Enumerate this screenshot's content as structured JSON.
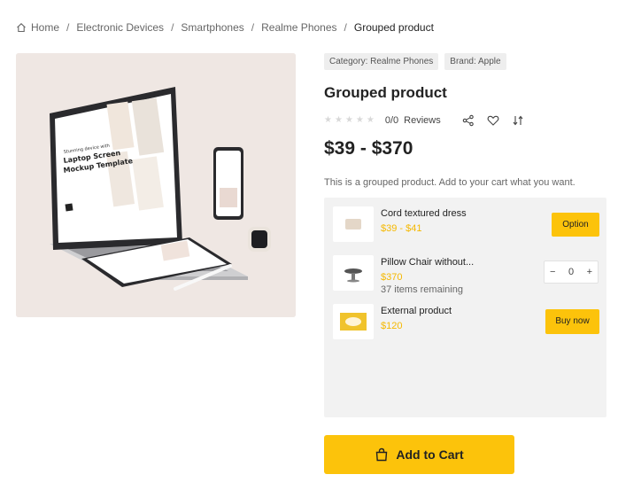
{
  "breadcrumb": {
    "items": [
      "Home",
      "Electronic Devices",
      "Smartphones",
      "Realme Phones",
      "Grouped product"
    ],
    "separator": "/"
  },
  "product": {
    "category_tag": "Category: Realme Phones",
    "brand_tag": "Brand: Apple",
    "title": "Grouped product",
    "rating": "0/0",
    "reviews_label": "Reviews",
    "price_range": "$39 - $370",
    "description": "This is a grouped product. Add to your cart what you want.",
    "add_to_cart_label": "Add to Cart"
  },
  "grouped_items": [
    {
      "name": "Cord textured dress",
      "price": "$39 - $41",
      "action_label": "Option"
    },
    {
      "name": "Pillow Chair without...",
      "price": "$370",
      "stock": "37 items remaining",
      "quantity": "0",
      "minus": "−",
      "plus": "+"
    },
    {
      "name": "External product",
      "price": "$120",
      "action_label": "Buy now"
    }
  ],
  "mockup_texts": {
    "laptop_line1": "Stunning device with",
    "laptop_line2": "Laptop Screen",
    "laptop_line3": "Mockup Template"
  },
  "colors": {
    "accent": "#fcc30b",
    "price_accent": "#f5b800",
    "panel": "#f2f2f2",
    "image_bg": "#efe7e3"
  },
  "icons": [
    "home-icon",
    "share-icon",
    "heart-icon",
    "compare-icon",
    "bag-icon"
  ]
}
